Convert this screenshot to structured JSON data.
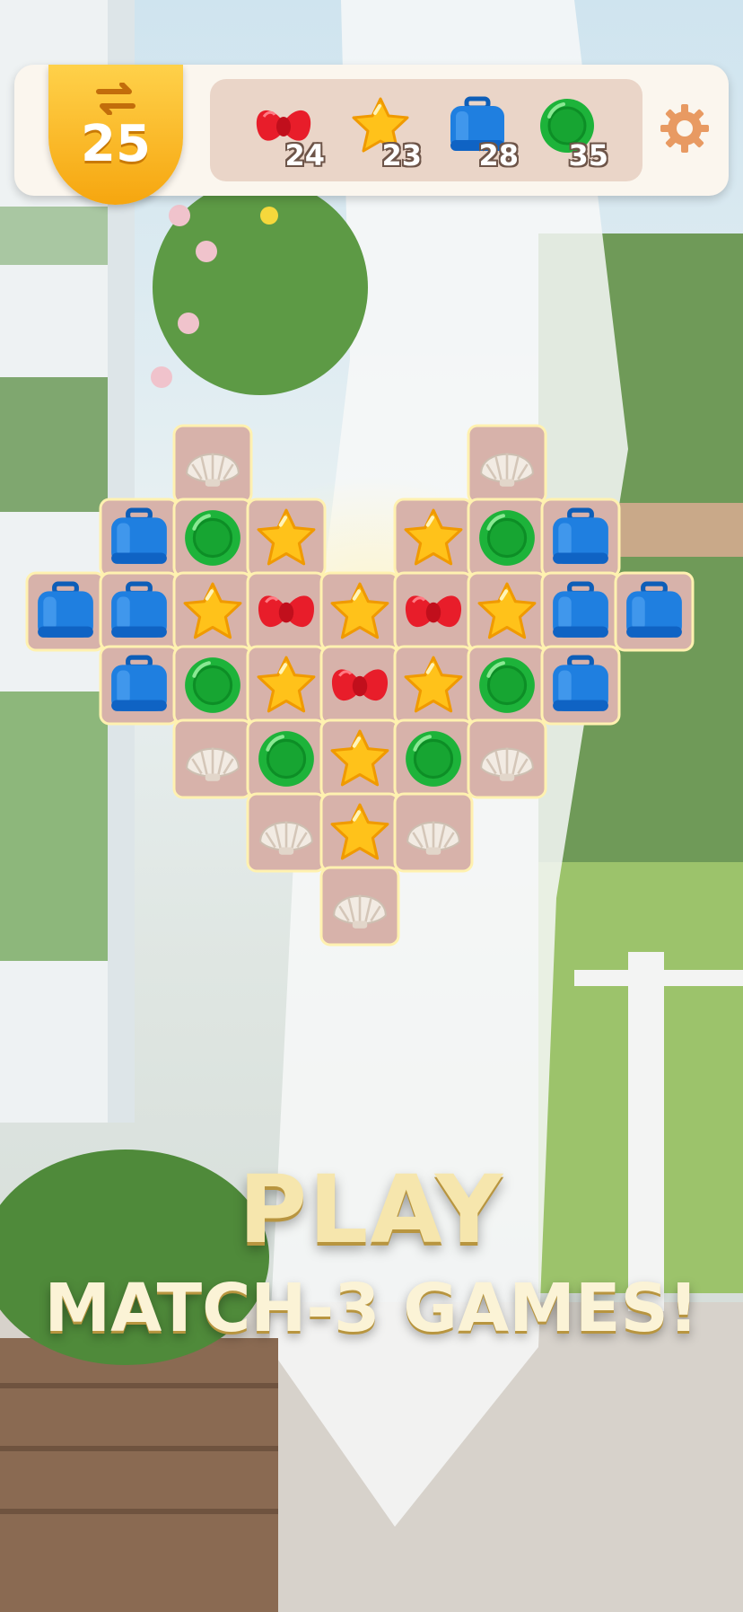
{
  "hud": {
    "moves": "25",
    "goals": [
      {
        "name": "bow",
        "count": "24"
      },
      {
        "name": "star",
        "count": "23"
      },
      {
        "name": "suitcase",
        "count": "28"
      },
      {
        "name": "button",
        "count": "35"
      }
    ]
  },
  "board": {
    "rows": [
      [
        null,
        null,
        "shell",
        null,
        null,
        null,
        "shell",
        null,
        null
      ],
      [
        null,
        "suitcase",
        "button",
        "star",
        null,
        "star",
        "button",
        "suitcase",
        null
      ],
      [
        "suitcase",
        "suitcase",
        "star",
        "bow",
        "star",
        "bow",
        "star",
        "suitcase",
        "suitcase"
      ],
      [
        null,
        "suitcase",
        "button",
        "star",
        "bow",
        "star",
        "button",
        "suitcase",
        null
      ],
      [
        null,
        null,
        "shell",
        "button",
        "star",
        "button",
        "shell",
        null,
        null
      ],
      [
        null,
        null,
        null,
        "shell",
        "star",
        "shell",
        null,
        null,
        null
      ],
      [
        null,
        null,
        null,
        null,
        "shell",
        null,
        null,
        null,
        null
      ]
    ]
  },
  "tagline": {
    "line1": "PLAY",
    "line2": "MATCH-3 GAMES!"
  },
  "colors": {
    "moves_badge": "#f6a60f",
    "tile": "#d7b2aa",
    "board_glow": "#fff1b0",
    "suitcase": "#1f7fe0",
    "button": "#1db33a",
    "star": "#ffc21a",
    "bow": "#e81d2a",
    "shell": "#f2ebe3"
  }
}
